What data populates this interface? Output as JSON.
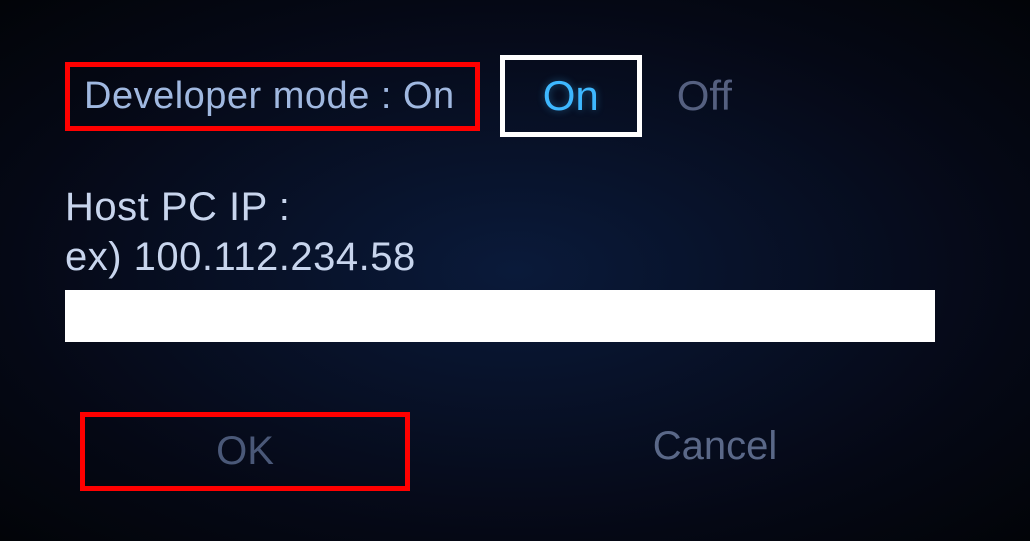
{
  "developerMode": {
    "label": "Developer mode : On",
    "onLabel": "On",
    "offLabel": "Off"
  },
  "hostPc": {
    "labelLine1": "Host PC IP :",
    "labelLine2": "ex) 100.112.234.58",
    "inputValue": "",
    "placeholder": ""
  },
  "buttons": {
    "ok": "OK",
    "cancel": "Cancel"
  }
}
